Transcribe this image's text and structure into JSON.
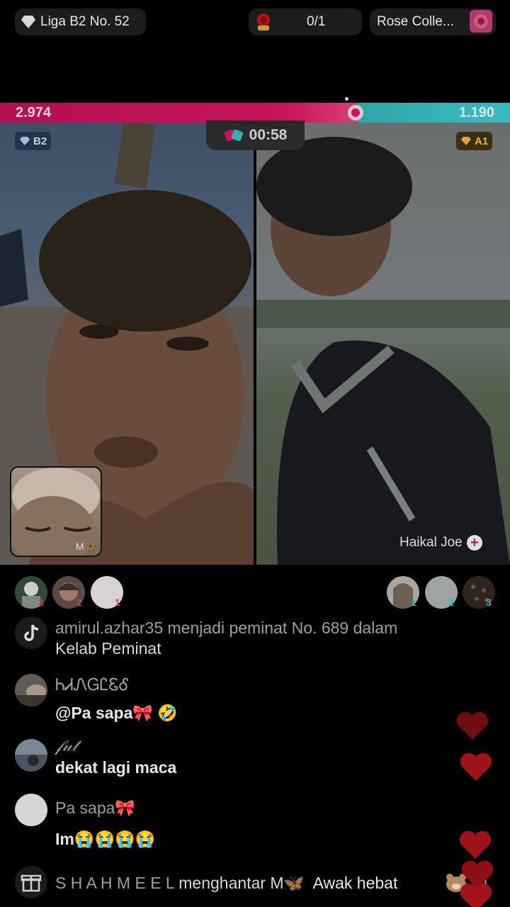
{
  "top_bar": {
    "league_label": "Liga B2 No. 52",
    "progress_label": "0/1",
    "collection_label": "Rose Colle..."
  },
  "battle": {
    "left_score": "2.974",
    "right_score": "1.190",
    "timer": "00:58",
    "left_tier": "B2",
    "right_tier": "A1",
    "guest_name": "M🦋",
    "right_host_name": "Haikal Joe"
  },
  "supporters": {
    "left": [
      {
        "rank": "3"
      },
      {
        "rank": "2"
      },
      {
        "rank": "1"
      }
    ],
    "right": [
      {
        "rank": "1"
      },
      {
        "rank": "2"
      },
      {
        "rank": "3"
      }
    ]
  },
  "comments": [
    {
      "name": "amirul.azhar35 menjadi peminat No. 689 dalam",
      "text": "Kelab Peminat"
    },
    {
      "name": "ᏂᏗᏁᏀᏝᏋᎴ",
      "text": "@Pa sapa🎀 🤣"
    },
    {
      "name": "𝒻𝓊𝓉",
      "text": "dekat lagi maca"
    },
    {
      "name": "Pa sapa🎀",
      "text": "Im😭😭😭😭"
    }
  ],
  "gift": {
    "sender": "S H A H M E E L",
    "action": "menghantar M🦋",
    "message": "Awak hebat",
    "count": "×1"
  },
  "colors": {
    "left_bar": "#c8145b",
    "right_bar": "#33b0b3",
    "heart": "#b3141b"
  }
}
